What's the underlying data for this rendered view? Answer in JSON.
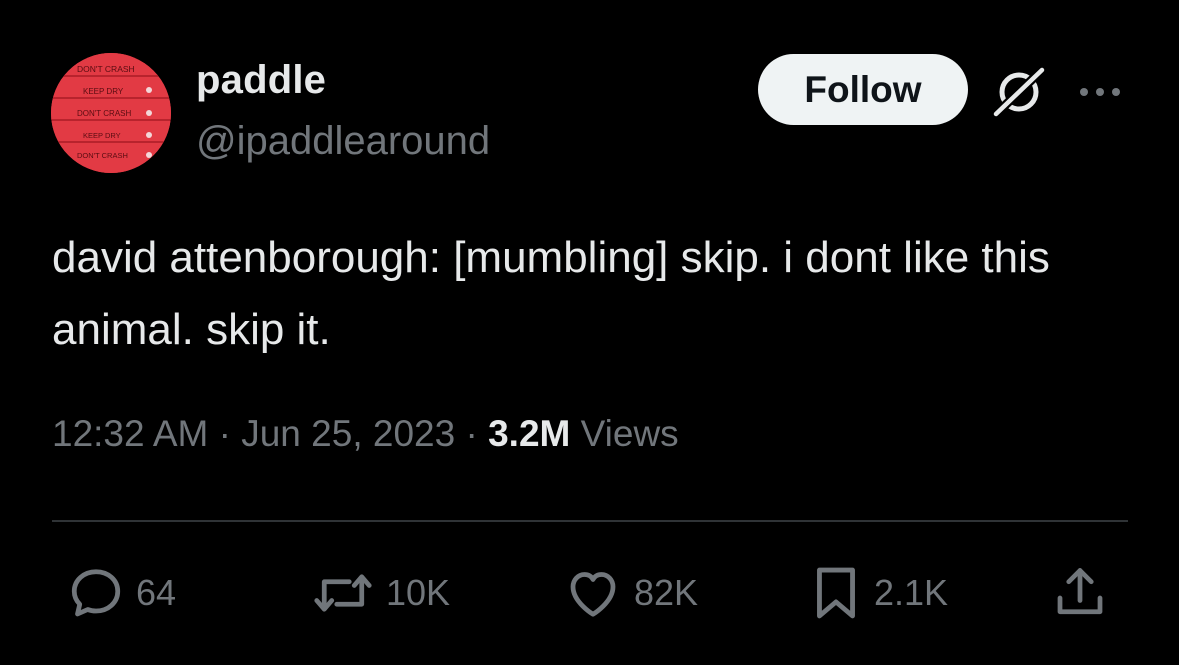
{
  "author": {
    "display_name": "paddle",
    "handle": "@ipaddlearound",
    "avatar_lines": [
      "DON'T CRASH",
      "KEEP DRY",
      "DON'T CRASH",
      "KEEP DRY",
      "DON'T CRASH"
    ]
  },
  "follow_label": "Follow",
  "tweet_text": "david attenborough: [mumbling] skip. i dont like this animal. skip it.",
  "meta": {
    "time": "12:32 AM",
    "separator": "·",
    "date": "Jun 25, 2023",
    "views_count": "3.2M",
    "views_label": "Views"
  },
  "actions": {
    "replies": "64",
    "reposts": "10K",
    "likes": "82K",
    "bookmarks": "2.1K"
  },
  "icons": {
    "grok": "grok-icon",
    "more": "more-icon",
    "reply": "reply-icon",
    "repost": "repost-icon",
    "like": "heart-icon",
    "bookmark": "bookmark-icon",
    "share": "share-icon"
  },
  "colors": {
    "background": "#000000",
    "primary_text": "#e7e9ea",
    "secondary_text": "#71767b",
    "follow_bg": "#eff3f4",
    "divider": "#2f3336",
    "avatar_red": "#e23a44"
  }
}
